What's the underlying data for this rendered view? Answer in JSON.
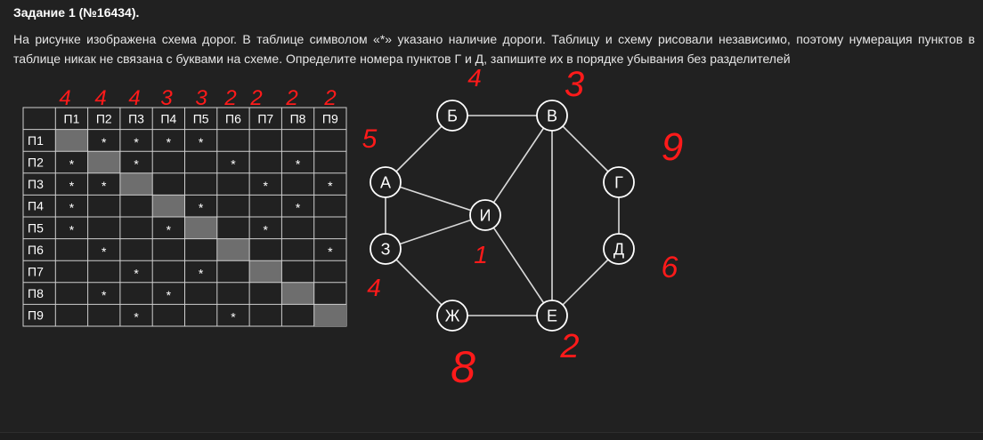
{
  "task": {
    "title": "Задание 1 (№16434).",
    "text": "На рисунке изображена схема дорог. В таблице символом «*» указано наличие дороги. Таблицу и схему рисовали независимо, поэтому нумерация пунктов в таблице никак не связана с буквами на схеме. Определите номера пунктов Г и Д, запишите их в порядке убывания без разделителей"
  },
  "table": {
    "headers": [
      "П1",
      "П2",
      "П3",
      "П4",
      "П5",
      "П6",
      "П7",
      "П8",
      "П9"
    ],
    "rows": [
      {
        "label": "П1",
        "cells": [
          "",
          "*",
          "*",
          "*",
          "*",
          "",
          "",
          "",
          ""
        ]
      },
      {
        "label": "П2",
        "cells": [
          "*",
          "",
          "*",
          "",
          "",
          "*",
          "",
          "*",
          ""
        ]
      },
      {
        "label": "П3",
        "cells": [
          "*",
          "*",
          "",
          "",
          "",
          "",
          "*",
          "",
          "*"
        ]
      },
      {
        "label": "П4",
        "cells": [
          "*",
          "",
          "",
          "",
          "*",
          "",
          "",
          "*",
          ""
        ]
      },
      {
        "label": "П5",
        "cells": [
          "*",
          "",
          "",
          "*",
          "",
          "",
          "*",
          "",
          ""
        ]
      },
      {
        "label": "П6",
        "cells": [
          "",
          "*",
          "",
          "",
          "",
          "",
          "",
          "",
          "*"
        ]
      },
      {
        "label": "П7",
        "cells": [
          "",
          "",
          "*",
          "",
          "*",
          "",
          "",
          "",
          ""
        ]
      },
      {
        "label": "П8",
        "cells": [
          "",
          "*",
          "",
          "*",
          "",
          "",
          "",
          "",
          ""
        ]
      },
      {
        "label": "П9",
        "cells": [
          "",
          "",
          "*",
          "",
          "",
          "*",
          "",
          "",
          ""
        ]
      }
    ],
    "diagonal_color": "#6e6e6e"
  },
  "graph": {
    "nodes": [
      {
        "id": "A",
        "label": "А"
      },
      {
        "id": "B",
        "label": "Б"
      },
      {
        "id": "V",
        "label": "В"
      },
      {
        "id": "G",
        "label": "Г"
      },
      {
        "id": "D",
        "label": "Д"
      },
      {
        "id": "E",
        "label": "Е"
      },
      {
        "id": "Zh",
        "label": "Ж"
      },
      {
        "id": "Z",
        "label": "З"
      },
      {
        "id": "I",
        "label": "И"
      }
    ],
    "edges": [
      [
        "A",
        "B"
      ],
      [
        "B",
        "V"
      ],
      [
        "V",
        "G"
      ],
      [
        "G",
        "D"
      ],
      [
        "D",
        "E"
      ],
      [
        "E",
        "Zh"
      ],
      [
        "Zh",
        "Z"
      ],
      [
        "Z",
        "A"
      ],
      [
        "A",
        "I"
      ],
      [
        "Z",
        "I"
      ],
      [
        "I",
        "V"
      ],
      [
        "I",
        "E"
      ],
      [
        "V",
        "E"
      ]
    ]
  },
  "annotations": {
    "color": "#ff1a1a",
    "column_marks": [
      "4",
      "4",
      "4",
      "3",
      "3",
      "2",
      "2",
      "2",
      "2"
    ],
    "node_marks": [
      {
        "node": "Б",
        "mark": "4"
      },
      {
        "node": "В",
        "mark": "3"
      },
      {
        "node": "Г",
        "mark": "9"
      },
      {
        "node": "Д",
        "mark": "6"
      },
      {
        "node": "Е",
        "mark": "2"
      },
      {
        "node": "Ж",
        "mark": "8"
      },
      {
        "node": "З",
        "mark": "4"
      },
      {
        "node": "А",
        "mark": "5"
      },
      {
        "node": "И",
        "mark": "1"
      }
    ]
  }
}
